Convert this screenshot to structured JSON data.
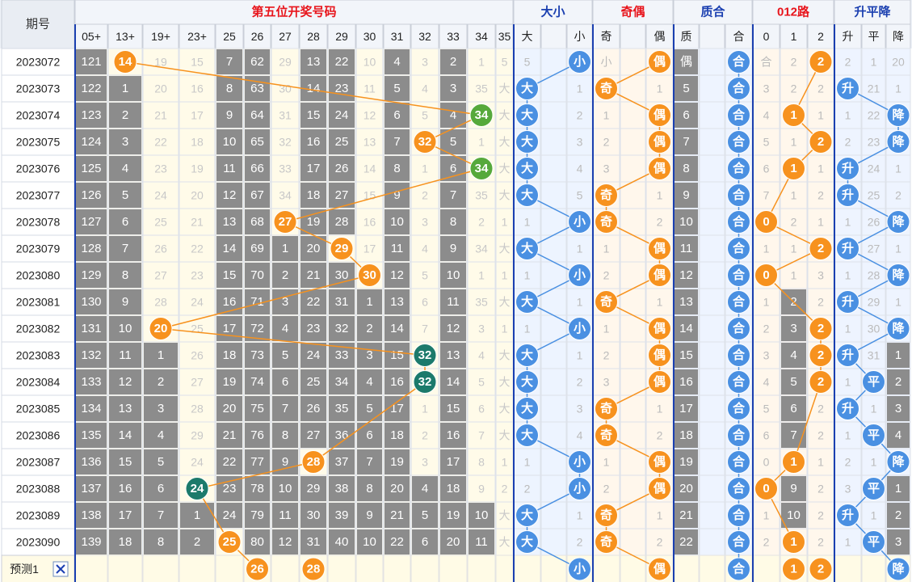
{
  "header": {
    "period_label": "期号",
    "group_labels": [
      "第五位开奖号码",
      "大小",
      "奇偶",
      "质合",
      "012路",
      "升平降"
    ],
    "number_columns": [
      "05+",
      "13+",
      "19+",
      "23+",
      "25",
      "26",
      "27",
      "28",
      "29",
      "30",
      "31",
      "32",
      "33",
      "34",
      "35"
    ],
    "big_small": [
      "大",
      "小"
    ],
    "odd_even": [
      "奇",
      "偶"
    ],
    "prime_composite": [
      "质",
      "合"
    ],
    "route": [
      "0",
      "1",
      "2"
    ],
    "trend": [
      "升",
      "平",
      "降"
    ]
  },
  "forecast": {
    "label": "预测1",
    "close_icon": "close-icon",
    "numbers": [
      "26",
      "28"
    ],
    "big_small": "小",
    "odd_even": "偶",
    "prime_composite": "合",
    "routes": [
      "1",
      "2"
    ],
    "trend": "降"
  },
  "colors": {
    "orange": "#f7921e",
    "green": "#56a93b",
    "teal": "#1c7a6b",
    "blue": "#4a90e2",
    "gray_cell": "#8c8c8c",
    "header_red": "#e8141b",
    "header_blue": "#1a3fb0"
  },
  "chart_data": {
    "type": "table",
    "periods": [
      "2023072",
      "2023073",
      "2023074",
      "2023075",
      "2023076",
      "2023077",
      "2023078",
      "2023079",
      "2023080",
      "2023081",
      "2023082",
      "2023083",
      "2023084",
      "2023085",
      "2023086",
      "2023087",
      "2023088",
      "2023089",
      "2023090"
    ],
    "cells": [
      [
        "121",
        "14",
        "19",
        "15",
        "7",
        "62",
        "29",
        "13",
        "22",
        "10",
        "4",
        "3",
        "2",
        "1",
        "5",
        "1",
        "小",
        "2",
        "偶",
        "4",
        "合",
        "2",
        "1",
        "2",
        "1",
        "20",
        "降"
      ],
      [
        "122",
        "1",
        "20",
        "16",
        "8",
        "63",
        "30",
        "14",
        "23",
        "11",
        "5",
        "4",
        "3",
        "35",
        "大",
        "1",
        "奇",
        "1",
        "5",
        "合",
        "3",
        "2",
        "2",
        "升",
        "21",
        "1"
      ],
      [
        "123",
        "2",
        "21",
        "17",
        "9",
        "64",
        "31",
        "15",
        "24",
        "12",
        "6",
        "5",
        "4",
        "34",
        "大",
        "2",
        "1",
        "偶",
        "6",
        "合",
        "4",
        "1",
        "1",
        "1",
        "22",
        "降"
      ],
      [
        "124",
        "3",
        "22",
        "18",
        "10",
        "65",
        "32",
        "16",
        "25",
        "13",
        "7",
        "32",
        "5",
        "1",
        "大",
        "3",
        "2",
        "偶",
        "7",
        "合",
        "5",
        "1",
        "2",
        "2",
        "23",
        "降"
      ],
      [
        "125",
        "4",
        "23",
        "19",
        "11",
        "66",
        "33",
        "17",
        "26",
        "14",
        "8",
        "1",
        "6",
        "34",
        "大",
        "4",
        "3",
        "偶",
        "8",
        "合",
        "6",
        "1",
        "1",
        "升",
        "24",
        "1"
      ],
      [
        "126",
        "5",
        "24",
        "20",
        "12",
        "67",
        "34",
        "18",
        "27",
        "15",
        "9",
        "2",
        "7",
        "35",
        "大",
        "5",
        "奇",
        "1",
        "9",
        "合",
        "7",
        "1",
        "2",
        "升",
        "25",
        "2"
      ],
      [
        "127",
        "6",
        "25",
        "21",
        "13",
        "68",
        "27",
        "19",
        "28",
        "16",
        "10",
        "3",
        "8",
        "2",
        "1",
        "小",
        "奇",
        "2",
        "10",
        "合",
        "0",
        "2",
        "1",
        "1",
        "26",
        "降"
      ],
      [
        "128",
        "7",
        "26",
        "22",
        "14",
        "69",
        "1",
        "20",
        "29",
        "17",
        "11",
        "4",
        "9",
        "34",
        "大",
        "1",
        "1",
        "偶",
        "11",
        "合",
        "1",
        "1",
        "2",
        "升",
        "27",
        "1"
      ],
      [
        "129",
        "8",
        "27",
        "23",
        "15",
        "70",
        "2",
        "21",
        "30",
        "30",
        "12",
        "5",
        "10",
        "1",
        "1",
        "小",
        "2",
        "偶",
        "12",
        "合",
        "0",
        "1",
        "3",
        "1",
        "28",
        "降"
      ],
      [
        "130",
        "9",
        "28",
        "24",
        "16",
        "71",
        "3",
        "22",
        "31",
        "1",
        "13",
        "6",
        "11",
        "35",
        "大",
        "1",
        "奇",
        "1",
        "13",
        "合",
        "1",
        "2",
        "2",
        "升",
        "29",
        "1"
      ],
      [
        "131",
        "10",
        "20",
        "25",
        "17",
        "72",
        "4",
        "23",
        "32",
        "2",
        "14",
        "7",
        "12",
        "3",
        "1",
        "小",
        "1",
        "偶",
        "14",
        "合",
        "2",
        "3",
        "2",
        "1",
        "30",
        "降"
      ],
      [
        "132",
        "11",
        "1",
        "26",
        "18",
        "73",
        "5",
        "24",
        "33",
        "3",
        "15",
        "32",
        "13",
        "4",
        "大",
        "1",
        "2",
        "偶",
        "15",
        "合",
        "3",
        "4",
        "2",
        "升",
        "31",
        "1"
      ],
      [
        "133",
        "12",
        "2",
        "27",
        "19",
        "74",
        "6",
        "25",
        "34",
        "4",
        "16",
        "32",
        "14",
        "5",
        "大",
        "2",
        "3",
        "偶",
        "16",
        "合",
        "4",
        "5",
        "2",
        "1",
        "平",
        "2"
      ],
      [
        "134",
        "13",
        "3",
        "28",
        "20",
        "75",
        "7",
        "26",
        "35",
        "5",
        "17",
        "1",
        "15",
        "6",
        "大",
        "3",
        "奇",
        "1",
        "17",
        "合",
        "5",
        "6",
        "2",
        "升",
        "1",
        "3"
      ],
      [
        "135",
        "14",
        "4",
        "29",
        "21",
        "76",
        "8",
        "27",
        "36",
        "6",
        "18",
        "2",
        "16",
        "7",
        "大",
        "4",
        "奇",
        "2",
        "18",
        "合",
        "6",
        "7",
        "2",
        "1",
        "平",
        "4"
      ],
      [
        "136",
        "15",
        "5",
        "24",
        "22",
        "77",
        "9",
        "28",
        "37",
        "7",
        "19",
        "3",
        "17",
        "8",
        "1",
        "小",
        "1",
        "偶",
        "19",
        "合",
        "0",
        "8",
        "1",
        "2",
        "1",
        "降"
      ],
      [
        "137",
        "16",
        "6",
        "24",
        "23",
        "78",
        "10",
        "29",
        "38",
        "8",
        "20",
        "4",
        "18",
        "9",
        "2",
        "小",
        "2",
        "偶",
        "20",
        "合",
        "0",
        "9",
        "2",
        "3",
        "平",
        "1"
      ],
      [
        "138",
        "17",
        "7",
        "1",
        "24",
        "79",
        "11",
        "30",
        "39",
        "9",
        "21",
        "5",
        "19",
        "10",
        "大",
        "1",
        "奇",
        "1",
        "21",
        "合",
        "1",
        "10",
        "2",
        "升",
        "1",
        "2"
      ],
      [
        "139",
        "18",
        "8",
        "2",
        "25",
        "80",
        "12",
        "31",
        "40",
        "10",
        "22",
        "6",
        "20",
        "11",
        "大",
        "2",
        "奇",
        "2",
        "22",
        "合",
        "2",
        "11",
        "2",
        "1",
        "平",
        "3"
      ]
    ]
  }
}
